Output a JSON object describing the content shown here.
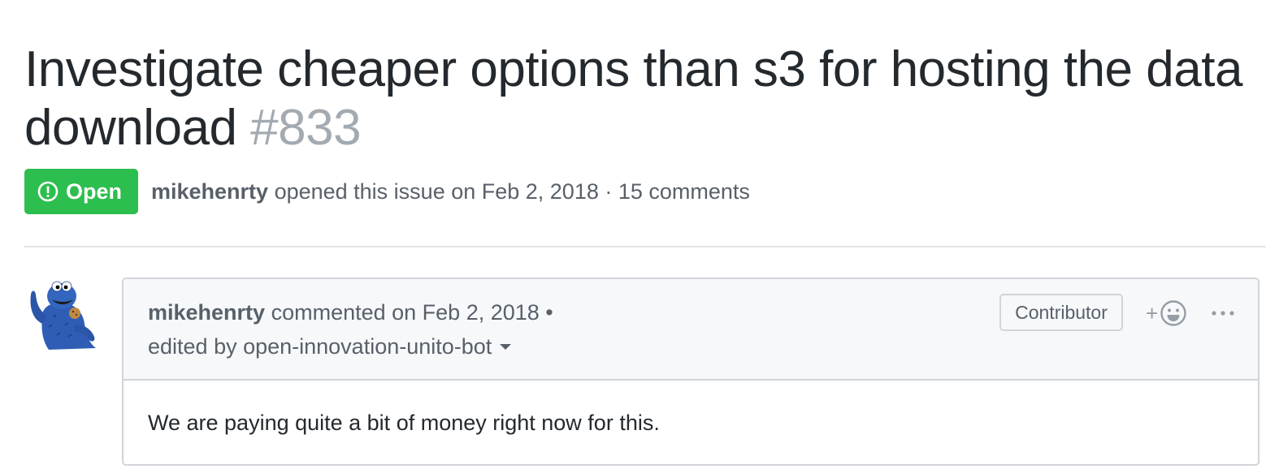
{
  "issue": {
    "title": "Investigate cheaper options than s3 for hosting the data download",
    "number": "#833",
    "state": "Open",
    "state_color": "#2cbe4e",
    "state_icon": "issue-opened-icon",
    "author": "mikehenrty",
    "opened_text": " opened this issue on Feb 2, 2018 · 15 comments"
  },
  "comment": {
    "author": "mikehenrty",
    "commented_text": " commented on Feb 2, 2018 •",
    "edited_text": "edited by open-innovation-unito-bot",
    "role_badge": "Contributor",
    "reaction_plus": "+",
    "reaction_icon": "smiley-icon",
    "more_icon": "kebab-horizontal-icon",
    "avatar": "cookie-monster-avatar",
    "body": "We are paying quite a bit of money right now for this."
  }
}
